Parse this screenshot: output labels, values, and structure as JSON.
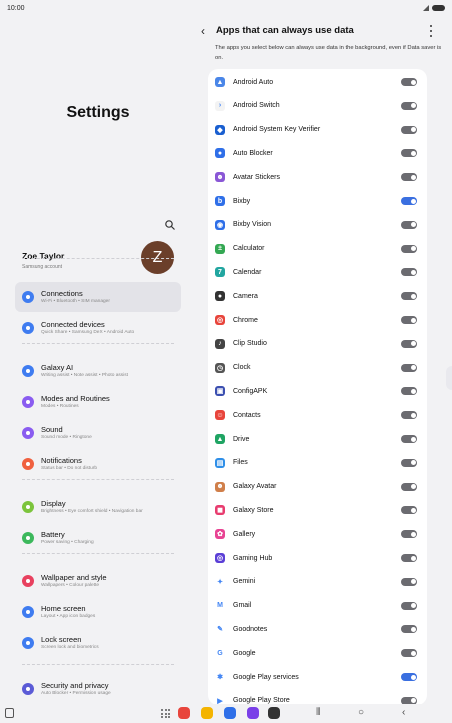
{
  "status": {
    "time": "10:00"
  },
  "settings": {
    "title": "Settings",
    "profile": {
      "name": "Zoe Taylor",
      "subtitle": "Samsung account",
      "initial": "Z"
    },
    "menu": [
      {
        "label": "Connections",
        "sub": "Wi-Fi • Bluetooth • SIM manager",
        "icon": "wifi-icon",
        "color": "#3f7cf0",
        "active": true
      },
      {
        "label": "Connected devices",
        "sub": "Quick Share • Samsung DeX • Android Auto",
        "icon": "devices-icon",
        "color": "#3f7cf0"
      },
      {
        "label": "Galaxy AI",
        "sub": "Writing assist • Note assist • Photo assist",
        "icon": "galaxy-ai-icon",
        "color": "#3f7cf0"
      },
      {
        "label": "Modes and Routines",
        "sub": "Modes • Routines",
        "icon": "modes-icon",
        "color": "#8a5cf0"
      },
      {
        "label": "Sound",
        "sub": "Sound mode • Ringtone",
        "icon": "sound-icon",
        "color": "#8a5cf0"
      },
      {
        "label": "Notifications",
        "sub": "Status bar • Do not disturb",
        "icon": "notifications-icon",
        "color": "#f0603f"
      },
      {
        "label": "Display",
        "sub": "Brightness • Eye comfort shield • Navigation bar",
        "icon": "display-icon",
        "color": "#7cc43c"
      },
      {
        "label": "Battery",
        "sub": "Power saving • Charging",
        "icon": "battery-icon",
        "color": "#3cb85c"
      },
      {
        "label": "Wallpaper and style",
        "sub": "Wallpapers • Colour palette",
        "icon": "wallpaper-icon",
        "color": "#e8415f"
      },
      {
        "label": "Home screen",
        "sub": "Layout • App icon badges",
        "icon": "home-icon",
        "color": "#3f7cf0"
      },
      {
        "label": "Lock screen",
        "sub": "Screen lock and biometrics",
        "icon": "lock-icon",
        "color": "#3f7cf0"
      },
      {
        "label": "Security and privacy",
        "sub": "Auto Blocker • Permission usage",
        "icon": "security-icon",
        "color": "#5b5bd6"
      }
    ]
  },
  "panel": {
    "title": "Apps that can always use data",
    "description": "The apps you select below can always use data in the background, even if Data saver is on.",
    "apps": [
      {
        "name": "Android Auto",
        "on": false,
        "color": "#4a86e8",
        "glyph": "▲"
      },
      {
        "name": "Android Switch",
        "on": false,
        "color": "#f3f3f3",
        "glyph": "›"
      },
      {
        "name": "Android System Key Verifier",
        "on": false,
        "color": "#1a5fd0",
        "glyph": "◆"
      },
      {
        "name": "Auto Blocker",
        "on": false,
        "color": "#2f6fe8",
        "glyph": "●"
      },
      {
        "name": "Avatar Stickers",
        "on": false,
        "color": "#8a57d6",
        "glyph": "☻"
      },
      {
        "name": "Bixby",
        "on": true,
        "color": "#2f6fe8",
        "glyph": "b"
      },
      {
        "name": "Bixby Vision",
        "on": false,
        "color": "#2f6fe8",
        "glyph": "◉"
      },
      {
        "name": "Calculator",
        "on": false,
        "color": "#34a853",
        "glyph": "±"
      },
      {
        "name": "Calendar",
        "on": false,
        "color": "#22a6a0",
        "glyph": "7"
      },
      {
        "name": "Camera",
        "on": false,
        "color": "#333333",
        "glyph": "●"
      },
      {
        "name": "Chrome",
        "on": false,
        "color": "#e8453c",
        "glyph": "◎"
      },
      {
        "name": "Clip Studio",
        "on": false,
        "color": "#444444",
        "glyph": "♪"
      },
      {
        "name": "Clock",
        "on": false,
        "color": "#555555",
        "glyph": "◷"
      },
      {
        "name": "ConfigAPK",
        "on": false,
        "color": "#3b4fb0",
        "glyph": "▣"
      },
      {
        "name": "Contacts",
        "on": false,
        "color": "#e8453c",
        "glyph": "☺"
      },
      {
        "name": "Drive",
        "on": false,
        "color": "#1fa463",
        "glyph": "▲"
      },
      {
        "name": "Files",
        "on": false,
        "color": "#2f8fe8",
        "glyph": "▤"
      },
      {
        "name": "Galaxy Avatar",
        "on": false,
        "color": "#d07f4a",
        "glyph": "☻"
      },
      {
        "name": "Galaxy Store",
        "on": false,
        "color": "#e83c6f",
        "glyph": "◼"
      },
      {
        "name": "Gallery",
        "on": false,
        "color": "#e84393",
        "glyph": "✿"
      },
      {
        "name": "Gaming Hub",
        "on": false,
        "color": "#5b3fd6",
        "glyph": "◎"
      },
      {
        "name": "Gemini",
        "on": false,
        "color": "#ffffff",
        "glyph": "✦"
      },
      {
        "name": "Gmail",
        "on": false,
        "color": "#ffffff",
        "glyph": "M"
      },
      {
        "name": "Goodnotes",
        "on": false,
        "color": "#ffffff",
        "glyph": "✎"
      },
      {
        "name": "Google",
        "on": false,
        "color": "#ffffff",
        "glyph": "G"
      },
      {
        "name": "Google Play services",
        "on": true,
        "color": "#ffffff",
        "glyph": "✱"
      },
      {
        "name": "Google Play Store",
        "on": false,
        "color": "#ffffff",
        "glyph": "▶"
      }
    ]
  },
  "taskbar": {
    "dock": [
      {
        "name": "dock-app-red",
        "color": "#e8453c"
      },
      {
        "name": "dock-app-yellow",
        "color": "#f4b400"
      },
      {
        "name": "dock-app-blue",
        "color": "#2f6fe8"
      },
      {
        "name": "dock-app-purple",
        "color": "#7a3fe8"
      },
      {
        "name": "dock-app-camera",
        "color": "#333333"
      }
    ]
  }
}
